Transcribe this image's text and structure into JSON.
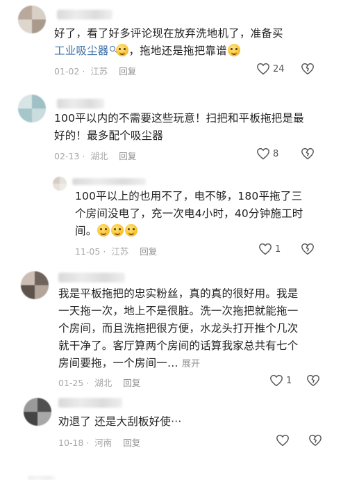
{
  "comments": [
    {
      "text_lines": [
        "好了，看了好多评论现在放弃洗地机了，准备买"
      ],
      "link_text": "工业吸尘器",
      "tail_text": "，拖地还是拖把靠谱",
      "date": "01-02",
      "location": "江苏",
      "reply": "回复",
      "likes": "24"
    },
    {
      "text_lines": [
        "100平以内的不需要这些玩意！扫把和平板拖把是最",
        "好的！最多配个吸尘器"
      ],
      "date": "02-13",
      "location": "湖北",
      "reply": "回复",
      "likes": "8"
    },
    {
      "text_lines": [
        "100平以上的也用不了，电不够，180平拖了三",
        "个房间没电了，充一次电4小时，40分钟施工时",
        "间。"
      ],
      "date": "11-05",
      "location": "江苏",
      "reply": "回复",
      "likes": "1"
    },
    {
      "text_lines": [
        "我是平板拖把的忠实粉丝，真的真的很好用。我是",
        "一天拖一次，地上不是很脏。洗一次拖把就能拖一",
        "个房间，而且洗拖把很方便，水龙头打开推个几次",
        "就干净了。客厅算两个房间的话算我家总共有七个",
        "房间要拖，一个房间一…"
      ],
      "expand": "展开",
      "date": "01-25",
      "location": "湖北",
      "reply": "回复",
      "likes": "1"
    },
    {
      "text_lines": [
        "劝退了 还是大刮板好使···"
      ],
      "date": "10-18",
      "location": "河南",
      "reply": "回复",
      "likes": ""
    }
  ],
  "separator": "·",
  "icons": {
    "like": "heart-outline-icon",
    "dislike": "broken-heart-outline-icon",
    "emoji": "laugh-cry-emoji-icon"
  },
  "colors": {
    "link": "#3a6ea5",
    "meta": "#a7a7a7",
    "text": "#222222"
  }
}
